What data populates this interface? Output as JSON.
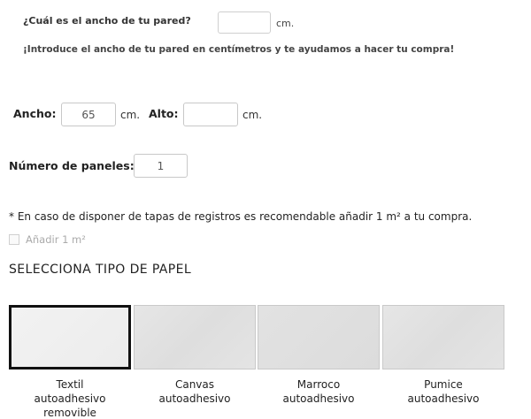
{
  "width_question": {
    "label": "¿Cuál es el ancho de tu pared?",
    "value": "",
    "unit": "cm.",
    "hint": "¡Introduce el ancho de tu pared en centímetros y te ayudamos a hacer tu compra!"
  },
  "dimensions": {
    "width_label": "Ancho:",
    "width_value": "65",
    "width_unit": "cm.",
    "height_label": "Alto:",
    "height_value": "",
    "height_unit": "cm."
  },
  "panels": {
    "label": "Número de paneles:",
    "value": "1"
  },
  "note": "* En caso de disponer de tapas de registros es recomendable añadir 1 m² a tu compra.",
  "add_checkbox": {
    "label": "Añadir 1 m²",
    "checked": false
  },
  "paper_section": {
    "title": "SELECCIONA TIPO DE PAPEL",
    "options": [
      {
        "label": "Textil\nautoadhesivo\nremovible",
        "selected": true
      },
      {
        "label": "Canvas\nautoadhesivo",
        "selected": false
      },
      {
        "label": "Marroco\nautoadhesivo",
        "selected": false
      },
      {
        "label": "Pumice\nautoadhesivo",
        "selected": false
      }
    ]
  }
}
